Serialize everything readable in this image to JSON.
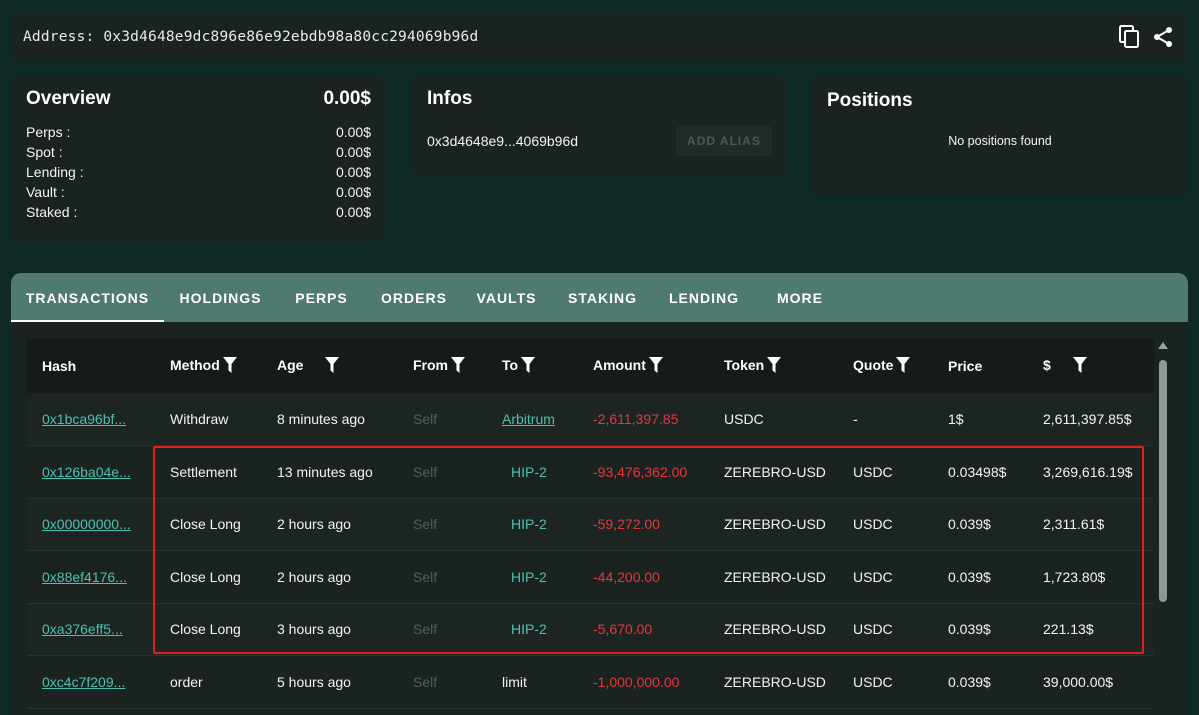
{
  "address_bar": {
    "label": "Address: 0x3d4648e9dc896e86e92ebdb98a80cc294069b96d",
    "icons": [
      "copy-icon",
      "share-icon"
    ]
  },
  "overview": {
    "title": "Overview",
    "total": "0.00$",
    "rows": [
      {
        "label": "Perps :",
        "value": "0.00$"
      },
      {
        "label": "Spot :",
        "value": "0.00$"
      },
      {
        "label": "Lending :",
        "value": "0.00$"
      },
      {
        "label": "Vault :",
        "value": "0.00$"
      },
      {
        "label": "Staked :",
        "value": "0.00$"
      }
    ]
  },
  "infos": {
    "title": "Infos",
    "short_address": "0x3d4648e9...4069b96d",
    "alias_button": "ADD ALIAS"
  },
  "positions": {
    "title": "Positions",
    "empty_text": "No positions found"
  },
  "tabs": [
    "TRANSACTIONS",
    "HOLDINGS",
    "PERPS",
    "ORDERS",
    "VAULTS",
    "STAKING",
    "LENDING",
    "MORE"
  ],
  "active_tab": "TRANSACTIONS",
  "table": {
    "headers": [
      "Hash",
      "Method",
      "Age",
      "From",
      "To",
      "Amount",
      "Token",
      "Quote",
      "Price",
      "$"
    ],
    "rows": [
      {
        "hash": "0x1bca96bf...",
        "method": "Withdraw",
        "age": "8 minutes ago",
        "from": "Self",
        "to": "Arbitrum",
        "amount": "-2,611,397.85",
        "token": "USDC",
        "quote": "-",
        "price": "1$",
        "usd": "2,611,397.85$"
      },
      {
        "hash": "0x126ba04e...",
        "method": "Settlement",
        "age": "13 minutes ago",
        "from": "Self",
        "to": "HIP-2",
        "amount": "-93,476,362.00",
        "token": "ZEREBRO-USD",
        "quote": "USDC",
        "price": "0.03498$",
        "usd": "3,269,616.19$"
      },
      {
        "hash": "0x00000000...",
        "method": "Close Long",
        "age": "2 hours ago",
        "from": "Self",
        "to": "HIP-2",
        "amount": "-59,272.00",
        "token": "ZEREBRO-USD",
        "quote": "USDC",
        "price": "0.039$",
        "usd": "2,311.61$"
      },
      {
        "hash": "0x88ef4176...",
        "method": "Close Long",
        "age": "2 hours ago",
        "from": "Self",
        "to": "HIP-2",
        "amount": "-44,200.00",
        "token": "ZEREBRO-USD",
        "quote": "USDC",
        "price": "0.039$",
        "usd": "1,723.80$"
      },
      {
        "hash": "0xa376eff5...",
        "method": "Close Long",
        "age": "3 hours ago",
        "from": "Self",
        "to": "HIP-2",
        "amount": "-5,670.00",
        "token": "ZEREBRO-USD",
        "quote": "USDC",
        "price": "0.039$",
        "usd": "221.13$"
      },
      {
        "hash": "0xc4c7f209...",
        "method": "order",
        "age": "5 hours ago",
        "from": "Self",
        "to": "limit",
        "amount": "-1,000,000.00",
        "token": "ZEREBRO-USD",
        "quote": "USDC",
        "price": "0.039$",
        "usd": "39,000.00$"
      }
    ]
  },
  "colors": {
    "page_bg": "#0f2a24",
    "card_bg": "#1b2321",
    "tab_bar": "#4f7a6f",
    "link": "#4ec0ae",
    "negative": "#e23a3a",
    "highlight_box": "#e21e1e"
  }
}
